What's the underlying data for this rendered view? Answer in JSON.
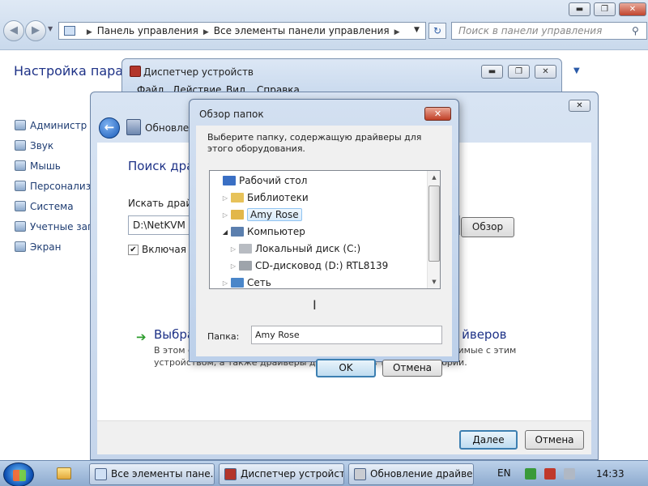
{
  "explorer": {
    "breadcrumb": [
      "Панель управления",
      "Все элементы панели управления"
    ],
    "search_placeholder": "Поиск в панели управления",
    "heading": "Настройка параме",
    "left_items": [
      "Администр",
      "Звук",
      "Мышь",
      "Персонализ",
      "Система",
      "Учетные запи",
      "Экран"
    ],
    "caption_minimize": "▬",
    "caption_maximize": "❐",
    "caption_close": "✕"
  },
  "device_manager": {
    "title": "Диспетчер устройств",
    "menu": [
      "Файл",
      "Действие",
      "Вид",
      "Справка"
    ]
  },
  "update_window": {
    "title": "Обновлени",
    "close": "✕",
    "heading": "Поиск драй",
    "search_label": "Искать драйве",
    "path_value": "D:\\NetKVM",
    "browse_button": "Обзор",
    "include_label": "Включая вл",
    "pick_title_left": "Выбра",
    "pick_title_right": "йверов",
    "pick_desc_line1_left": "В этом с",
    "pick_desc_line1_right": "стимые с этим",
    "pick_desc_line2": "устройством, а также драйверы для устройств той же категории.",
    "next_button": "Далее",
    "cancel_button": "Отмена"
  },
  "browse_dialog": {
    "title": "Обзор папок",
    "close": "✕",
    "description": "Выберите папку, содержащую драйверы для этого оборудования.",
    "tree": [
      {
        "label": "Рабочий стол",
        "expander": "",
        "icon": "desktop-icon",
        "color": "#3a6fc4",
        "level": 0
      },
      {
        "label": "Библиотеки",
        "expander": "▷",
        "icon": "libraries-icon",
        "color": "#e7c25a",
        "level": 1
      },
      {
        "label": "Amy Rose",
        "expander": "▷",
        "icon": "user-folder-icon",
        "color": "#e2b74a",
        "level": 1,
        "selected": true
      },
      {
        "label": "Компьютер",
        "expander": "◢",
        "icon": "computer-icon",
        "color": "#5b7fae",
        "level": 1
      },
      {
        "label": "Локальный диск (C:)",
        "expander": "▷",
        "icon": "hard-disk-icon",
        "color": "#b8bcc2",
        "level": 2
      },
      {
        "label": "CD-дисковод (D:) RTL8139",
        "expander": "▷",
        "icon": "cd-drive-icon",
        "color": "#9ea4ab",
        "level": 2
      },
      {
        "label": "Сеть",
        "expander": "▷",
        "icon": "network-icon",
        "color": "#4a86c9",
        "level": 1
      }
    ],
    "folder_label": "Папка:",
    "folder_value": "Amy Rose",
    "ok_button": "OK",
    "cancel_button": "Отмена"
  },
  "taskbar": {
    "tasks": [
      "Все элементы пане...",
      "Диспетчер устройств",
      "Обновление драйве..."
    ],
    "lang": "EN",
    "time": "14:33"
  }
}
